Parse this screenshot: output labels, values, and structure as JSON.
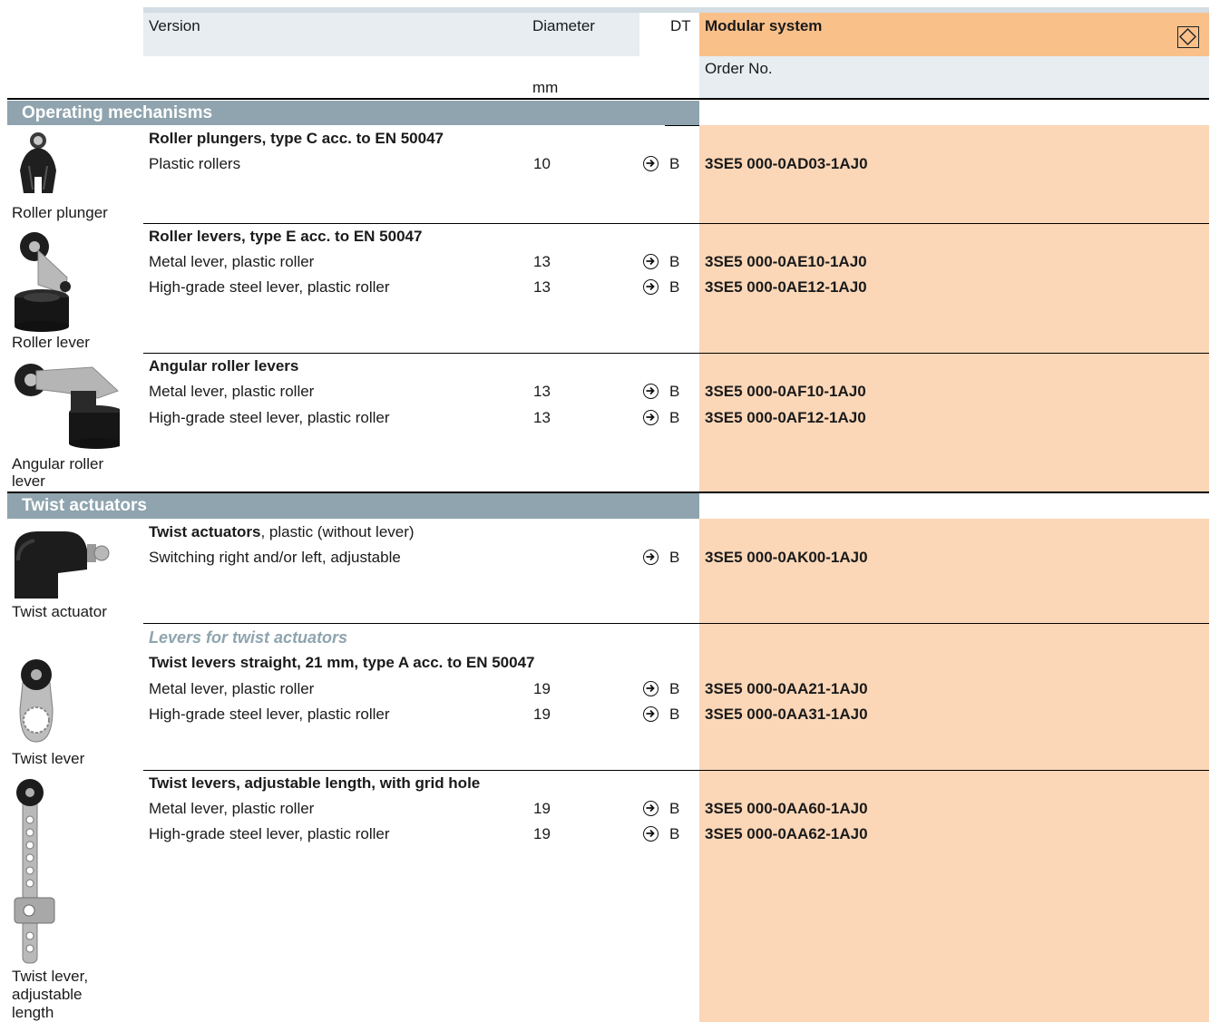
{
  "header": {
    "version": "Version",
    "diameter": "Diameter",
    "dt": "DT",
    "modular_system": "Modular system",
    "order_no": "Order No.",
    "unit": "mm"
  },
  "sections": {
    "operating": "Operating mechanisms",
    "twist": "Twist actuators"
  },
  "images": {
    "roller_plunger": "Roller plunger",
    "roller_lever": "Roller lever",
    "angular_line1": "Angular roller",
    "angular_line2": "lever",
    "twist_actuator": "Twist actuator",
    "twist_lever": "Twist lever",
    "twist_adj_line1": "Twist lever,",
    "twist_adj_line2": "adjustable",
    "twist_adj_line3": "length"
  },
  "groups": {
    "roller_plungers": "Roller plungers, type C acc. to EN 50047",
    "roller_levers": "Roller levers, type E acc. to EN 50047",
    "angular_roller_levers": "Angular roller levers",
    "twist_actuators_bold": "Twist actuators",
    "twist_actuators_rest": ", plastic (without lever)",
    "levers_for_twist": "Levers for twist actuators",
    "twist_levers_straight": "Twist levers straight, 21 mm, type A acc. to EN 50047",
    "twist_levers_adjustable": "Twist levers, adjustable length, with grid hole"
  },
  "rows": {
    "r1": {
      "desc": "Plastic rollers",
      "dia": "10",
      "dt": "B",
      "order": "3SE5 000-0AD03-1AJ0"
    },
    "r2": {
      "desc": "Metal lever, plastic roller",
      "dia": "13",
      "dt": "B",
      "order": "3SE5 000-0AE10-1AJ0"
    },
    "r3": {
      "desc": "High-grade steel lever, plastic roller",
      "dia": "13",
      "dt": "B",
      "order": "3SE5 000-0AE12-1AJ0"
    },
    "r4": {
      "desc": "Metal lever, plastic roller",
      "dia": "13",
      "dt": "B",
      "order": "3SE5 000-0AF10-1AJ0"
    },
    "r5": {
      "desc": "High-grade steel lever, plastic roller",
      "dia": "13",
      "dt": "B",
      "order": "3SE5 000-0AF12-1AJ0"
    },
    "r6": {
      "desc": "Switching right and/or left, adjustable",
      "dia": "",
      "dt": "B",
      "order": "3SE5 000-0AK00-1AJ0"
    },
    "r7": {
      "desc": "Metal lever, plastic roller",
      "dia": "19",
      "dt": "B",
      "order": "3SE5 000-0AA21-1AJ0"
    },
    "r8": {
      "desc": "High-grade steel lever, plastic roller",
      "dia": "19",
      "dt": "B",
      "order": "3SE5 000-0AA31-1AJ0"
    },
    "r9": {
      "desc": "Metal lever, plastic roller",
      "dia": "19",
      "dt": "B",
      "order": "3SE5 000-0AA60-1AJ0"
    },
    "r10": {
      "desc": "High-grade steel lever, plastic roller",
      "dia": "19",
      "dt": "B",
      "order": "3SE5 000-0AA62-1AJ0"
    }
  },
  "colors": {
    "section_bar": "#8fa4ae",
    "order_column": "#fbd7b8",
    "modular_header": "#f9c08a",
    "header_cell": "#e7edf1"
  }
}
